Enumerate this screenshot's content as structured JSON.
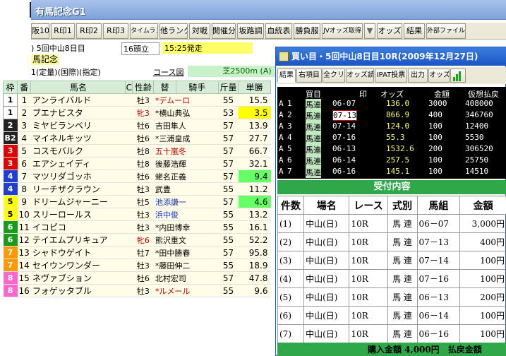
{
  "app": {
    "title": "有馬記念G1"
  },
  "toolbar": [
    "阪10",
    "R印1",
    "R印2",
    "R印3",
    "タイムランク",
    "他ランク",
    "対戦",
    "開催分",
    "坂路調",
    "血統表",
    "勝負服",
    "JVオッズ取得",
    "▼",
    "オッズ",
    "結果",
    "外部ファイル"
  ],
  "race": {
    "meet": ") 5回中山8日目",
    "runners": "16頭立",
    "post": "15:25発走",
    "name": "馬記念",
    "cond": "1(定量)(国際)(指定)",
    "course_link": "コース図",
    "distance": "芝2500m (A)"
  },
  "columns": [
    "枠",
    "番",
    "馬名",
    "C",
    "性齢",
    "替",
    "騎手",
    "斤量",
    "単勝"
  ],
  "horses": [
    {
      "waku": "1",
      "num": "1",
      "name": "アンライバルド",
      "sex": "牡3",
      "chg": "*",
      "jockey": "デムーロ",
      "wt": "55",
      "odds": "15.5",
      "wc": "#ffffff",
      "wt_text": "#000000",
      "jc": "red",
      "hl": ""
    },
    {
      "waku": "1",
      "num": "2",
      "name": "ブエナビスタ",
      "sex": "牝3",
      "chg": "*",
      "jockey": "横山典弘",
      "wt": "53",
      "odds": "3.5",
      "wc": "#ffffff",
      "wt_text": "#000000",
      "jc": "",
      "hl": "y",
      "fem": true
    },
    {
      "waku": "2",
      "num": "3",
      "name": "ミヤビランベリ",
      "sex": "牡6",
      "chg": "",
      "jockey": "吉田隼人",
      "wt": "57",
      "odds": "13.9",
      "wc": "#222222",
      "wt_text": "#ffffff",
      "jc": "",
      "hl": ""
    },
    {
      "waku": "B2",
      "num": "4",
      "name": "マイネルキッツ",
      "sex": "牡6",
      "chg": "*",
      "jockey": "三浦皇成",
      "wt": "57",
      "odds": "27.7",
      "wc": "#222222",
      "wt_text": "#ffffff",
      "jc": "",
      "hl": ""
    },
    {
      "waku": "3",
      "num": "5",
      "name": "コスモバルク",
      "sex": "牡8",
      "chg": "",
      "jockey": "五十嵐冬",
      "wt": "57",
      "odds": "66.7",
      "wc": "#e00000",
      "wt_text": "#ffffff",
      "jc": "red",
      "hl": ""
    },
    {
      "waku": "3",
      "num": "6",
      "name": "エアシェイディ",
      "sex": "牡8",
      "chg": "",
      "jockey": "後藤浩輝",
      "wt": "57",
      "odds": "32.1",
      "wc": "#e00000",
      "wt_text": "#ffffff",
      "jc": "",
      "hl": ""
    },
    {
      "waku": "4",
      "num": "7",
      "name": "マツリダゴッホ",
      "sex": "牡6",
      "chg": "",
      "jockey": "蛯名正義",
      "wt": "57",
      "odds": "9.4",
      "wc": "#1f3fd0",
      "wt_text": "#ffffff",
      "jc": "",
      "hl": "g"
    },
    {
      "waku": "4",
      "num": "8",
      "name": "リーチザクラウン",
      "sex": "牡3",
      "chg": "",
      "jockey": "武豊",
      "wt": "55",
      "odds": "11.2",
      "wc": "#1f3fd0",
      "wt_text": "#ffffff",
      "jc": "",
      "hl": ""
    },
    {
      "waku": "5",
      "num": "9",
      "name": "ドリームジャーニー",
      "sex": "牡5",
      "chg": "",
      "jockey": "池添謙一",
      "wt": "57",
      "odds": "4.6",
      "wc": "#ffff00",
      "wt_text": "#000000",
      "jc": "blu",
      "hl": "g"
    },
    {
      "waku": "5",
      "num": "10",
      "name": "スリーロールス",
      "sex": "牡3",
      "chg": "",
      "jockey": "浜中俊",
      "wt": "55",
      "odds": "13.2",
      "wc": "#ffff00",
      "wt_text": "#000000",
      "jc": "blu",
      "hl": ""
    },
    {
      "waku": "6",
      "num": "11",
      "name": "イコピコ",
      "sex": "牡3",
      "chg": "*",
      "jockey": "内田博幸",
      "wt": "55",
      "odds": "16.1",
      "wc": "#1a9a1a",
      "wt_text": "#ffffff",
      "jc": "",
      "hl": ""
    },
    {
      "waku": "6",
      "num": "12",
      "name": "テイエムプリキュア",
      "sex": "牝6",
      "chg": "",
      "jockey": "熊沢重文",
      "wt": "55",
      "odds": "52.2",
      "wc": "#1a9a1a",
      "wt_text": "#ffffff",
      "jc": "",
      "hl": "",
      "fem": true
    },
    {
      "waku": "7",
      "num": "13",
      "name": "シャドウゲイト",
      "sex": "牡7",
      "chg": "*",
      "jockey": "田中勝春",
      "wt": "57",
      "odds": "95.8",
      "wc": "#ff9900",
      "wt_text": "#ffffff",
      "jc": "",
      "hl": ""
    },
    {
      "waku": "7",
      "num": "14",
      "name": "セイウンワンダー",
      "sex": "牡3",
      "chg": "*",
      "jockey": "藤田伸二",
      "wt": "55",
      "odds": "18.9",
      "wc": "#ff9900",
      "wt_text": "#ffffff",
      "jc": "",
      "hl": ""
    },
    {
      "waku": "8",
      "num": "15",
      "name": "ネヴァブション",
      "sex": "牡6",
      "chg": "",
      "jockey": "北村宏司",
      "wt": "57",
      "odds": "47.8",
      "wc": "#ff66cc",
      "wt_text": "#ffffff",
      "jc": "",
      "hl": ""
    },
    {
      "waku": "8",
      "num": "16",
      "name": "フォゲッタブル",
      "sex": "牡3",
      "chg": "*",
      "jockey": "ルメール",
      "wt": "55",
      "odds": "9.6",
      "wc": "#ff66cc",
      "wt_text": "#ffffff",
      "jc": "red",
      "hl": ""
    }
  ],
  "popup": {
    "title": "買い目・5回中山8日目10R(2009年12月27日)",
    "buttons": [
      "結果",
      "右項目",
      "全クリア",
      "オッズ読",
      "IPAT投票",
      "出力",
      "オッズ'"
    ],
    "ticket_head": [
      "買目",
      "印",
      "オッズ",
      "金額",
      "仮想払戻"
    ],
    "tickets": [
      {
        "a": "A",
        "n": "1",
        "type": "馬連",
        "comb": "06-07",
        "odds": "136.0",
        "amt": "3000",
        "pay": "408000"
      },
      {
        "a": "A",
        "n": "2",
        "type": "馬連",
        "comb": "07-13",
        "odds": "866.9",
        "amt": "400",
        "pay": "346760"
      },
      {
        "a": "A",
        "n": "3",
        "type": "馬連",
        "comb": "07-14",
        "odds": "124.0",
        "amt": "100",
        "pay": "12400"
      },
      {
        "a": "A",
        "n": "4",
        "type": "馬連",
        "comb": "07-16",
        "odds": "55.3",
        "amt": "100",
        "pay": "5530"
      },
      {
        "a": "A",
        "n": "5",
        "type": "馬連",
        "comb": "06-13",
        "odds": "1532.6",
        "amt": "200",
        "pay": "306520"
      },
      {
        "a": "A",
        "n": "6",
        "type": "馬連",
        "comb": "06-14",
        "odds": "257.5",
        "amt": "100",
        "pay": "25750"
      },
      {
        "a": "A",
        "n": "7",
        "type": "馬連",
        "comb": "06-16",
        "odds": "145.1",
        "amt": "100",
        "pay": "14510"
      }
    ],
    "recv_title": "受付内容",
    "recv_cols": [
      "件数",
      "場名",
      "レース",
      "式別",
      "馬組",
      "金額"
    ],
    "recv_rows": [
      [
        "(1)",
        "中山(日)",
        "10R",
        "馬 連",
        "06－07",
        "3,000円"
      ],
      [
        "(2)",
        "中山(日)",
        "10R",
        "馬 連",
        "07－13",
        "400円"
      ],
      [
        "(3)",
        "中山(日)",
        "10R",
        "馬 連",
        "07－14",
        "100円"
      ],
      [
        "(4)",
        "中山(日)",
        "10R",
        "馬 連",
        "07－16",
        "100円"
      ],
      [
        "(5)",
        "中山(日)",
        "10R",
        "馬 連",
        "06－13",
        "200円"
      ],
      [
        "(6)",
        "中山(日)",
        "10R",
        "馬 連",
        "06－14",
        "100円"
      ],
      [
        "(7)",
        "中山(日)",
        "10R",
        "馬 連",
        "06－16",
        "100円"
      ]
    ],
    "total": "購入金額 4,000円　払戻金額"
  }
}
